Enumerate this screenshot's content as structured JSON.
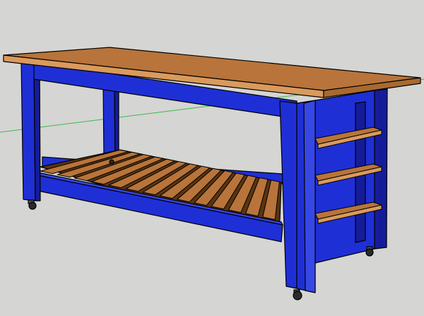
{
  "scene": {
    "model": "kitchen-island-workbench",
    "view": "3d-perspective",
    "colors": {
      "background": "#d5d5d3",
      "frame_blue": "#1f2fd6",
      "frame_blue_light": "#3747e6",
      "frame_blue_dark": "#141c9a",
      "wood_top": "#b8743a",
      "wood_edge": "#d99a5c",
      "wood_dark": "#8a4e22",
      "slat_shadow": "#5a3412",
      "axis_green": "#3cb84a",
      "caster": "#2a2a2a"
    },
    "components": {
      "top_board_count": 1,
      "bottom_shelf_slat_count": 14,
      "side_shelf_count": 3,
      "leg_count": 4,
      "caster_count": 4
    }
  }
}
